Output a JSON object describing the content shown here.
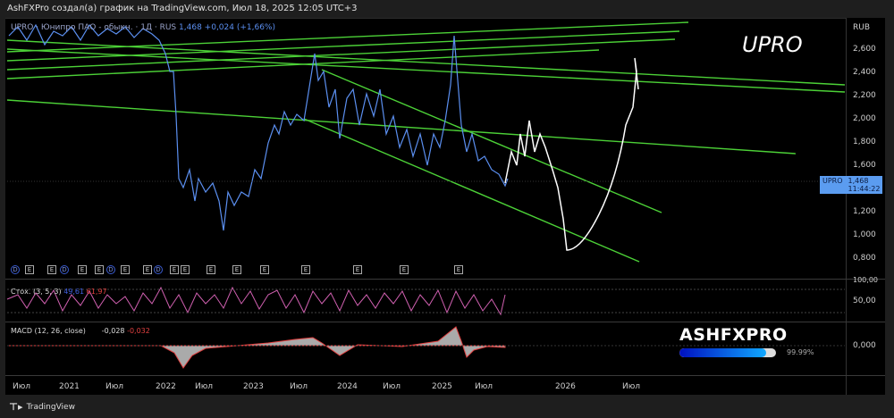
{
  "header": {
    "title": "AshFXPro создал(а) график на TradingView.com, Июл 18, 2025 12:05 UTC+3"
  },
  "legend": {
    "symbol": "UPRO · Юнипро ПАО - обыкн. · 1Д · RUS",
    "price": "1,468",
    "change": "+0,024 (+1,66%)"
  },
  "annotation": "UPRO",
  "price_axis": {
    "currency": "RUB",
    "labels": [
      "2,600",
      "2,400",
      "2,200",
      "2,000",
      "1,800",
      "1,600",
      "1,200",
      "1,000",
      "0,800"
    ]
  },
  "price_tag": {
    "symbol": "UPRO",
    "price": "1,468",
    "countdown": "11:44:22"
  },
  "time_axis": [
    "Июл",
    "2021",
    "Июл",
    "2022",
    "Июл",
    "2023",
    "Июл",
    "2024",
    "Июл",
    "2025",
    "Июл",
    "2026",
    "Июл"
  ],
  "markers": [
    "D",
    "E",
    "E",
    "D",
    "E",
    "E",
    "D",
    "E",
    "E",
    "D",
    "E",
    "E",
    "E",
    "E",
    "E",
    "E",
    "E",
    "E",
    "E"
  ],
  "stoch": {
    "label": "Стох. (3, 5, 3)",
    "k": "49,61",
    "d": "61,97",
    "axis": [
      "100,00",
      "50,00"
    ]
  },
  "macd": {
    "label": "MACD (12, 26, close)",
    "macd": "-0,028",
    "signal": "-0,032",
    "axis": "0,000"
  },
  "watermark": {
    "brand": "ASHFXPRO",
    "progress": 99.99,
    "progress_label": "99.99%"
  },
  "footer": {
    "brand": "TradingView"
  },
  "colors": {
    "price": "#5b8ff0",
    "trend": "#4cd137",
    "stoch_k": "#4060e0",
    "stoch_d": "#e060a0",
    "macd": "#e04040"
  }
}
